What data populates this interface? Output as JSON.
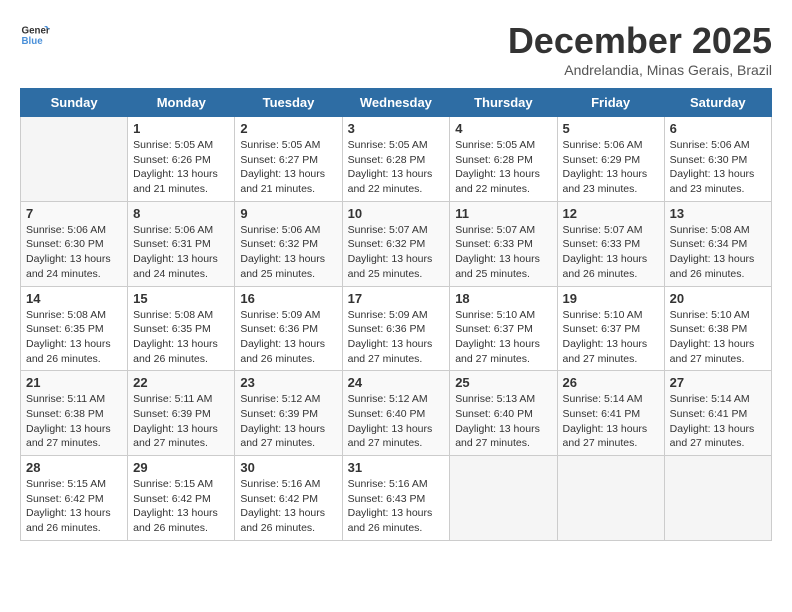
{
  "logo": {
    "general": "General",
    "blue": "Blue"
  },
  "header": {
    "month": "December 2025",
    "location": "Andrelandia, Minas Gerais, Brazil"
  },
  "days_of_week": [
    "Sunday",
    "Monday",
    "Tuesday",
    "Wednesday",
    "Thursday",
    "Friday",
    "Saturday"
  ],
  "weeks": [
    [
      {
        "day": "",
        "info": ""
      },
      {
        "day": "1",
        "info": "Sunrise: 5:05 AM\nSunset: 6:26 PM\nDaylight: 13 hours and 21 minutes."
      },
      {
        "day": "2",
        "info": "Sunrise: 5:05 AM\nSunset: 6:27 PM\nDaylight: 13 hours and 21 minutes."
      },
      {
        "day": "3",
        "info": "Sunrise: 5:05 AM\nSunset: 6:28 PM\nDaylight: 13 hours and 22 minutes."
      },
      {
        "day": "4",
        "info": "Sunrise: 5:05 AM\nSunset: 6:28 PM\nDaylight: 13 hours and 22 minutes."
      },
      {
        "day": "5",
        "info": "Sunrise: 5:06 AM\nSunset: 6:29 PM\nDaylight: 13 hours and 23 minutes."
      },
      {
        "day": "6",
        "info": "Sunrise: 5:06 AM\nSunset: 6:30 PM\nDaylight: 13 hours and 23 minutes."
      }
    ],
    [
      {
        "day": "7",
        "info": "Sunrise: 5:06 AM\nSunset: 6:30 PM\nDaylight: 13 hours and 24 minutes."
      },
      {
        "day": "8",
        "info": "Sunrise: 5:06 AM\nSunset: 6:31 PM\nDaylight: 13 hours and 24 minutes."
      },
      {
        "day": "9",
        "info": "Sunrise: 5:06 AM\nSunset: 6:32 PM\nDaylight: 13 hours and 25 minutes."
      },
      {
        "day": "10",
        "info": "Sunrise: 5:07 AM\nSunset: 6:32 PM\nDaylight: 13 hours and 25 minutes."
      },
      {
        "day": "11",
        "info": "Sunrise: 5:07 AM\nSunset: 6:33 PM\nDaylight: 13 hours and 25 minutes."
      },
      {
        "day": "12",
        "info": "Sunrise: 5:07 AM\nSunset: 6:33 PM\nDaylight: 13 hours and 26 minutes."
      },
      {
        "day": "13",
        "info": "Sunrise: 5:08 AM\nSunset: 6:34 PM\nDaylight: 13 hours and 26 minutes."
      }
    ],
    [
      {
        "day": "14",
        "info": "Sunrise: 5:08 AM\nSunset: 6:35 PM\nDaylight: 13 hours and 26 minutes."
      },
      {
        "day": "15",
        "info": "Sunrise: 5:08 AM\nSunset: 6:35 PM\nDaylight: 13 hours and 26 minutes."
      },
      {
        "day": "16",
        "info": "Sunrise: 5:09 AM\nSunset: 6:36 PM\nDaylight: 13 hours and 26 minutes."
      },
      {
        "day": "17",
        "info": "Sunrise: 5:09 AM\nSunset: 6:36 PM\nDaylight: 13 hours and 27 minutes."
      },
      {
        "day": "18",
        "info": "Sunrise: 5:10 AM\nSunset: 6:37 PM\nDaylight: 13 hours and 27 minutes."
      },
      {
        "day": "19",
        "info": "Sunrise: 5:10 AM\nSunset: 6:37 PM\nDaylight: 13 hours and 27 minutes."
      },
      {
        "day": "20",
        "info": "Sunrise: 5:10 AM\nSunset: 6:38 PM\nDaylight: 13 hours and 27 minutes."
      }
    ],
    [
      {
        "day": "21",
        "info": "Sunrise: 5:11 AM\nSunset: 6:38 PM\nDaylight: 13 hours and 27 minutes."
      },
      {
        "day": "22",
        "info": "Sunrise: 5:11 AM\nSunset: 6:39 PM\nDaylight: 13 hours and 27 minutes."
      },
      {
        "day": "23",
        "info": "Sunrise: 5:12 AM\nSunset: 6:39 PM\nDaylight: 13 hours and 27 minutes."
      },
      {
        "day": "24",
        "info": "Sunrise: 5:12 AM\nSunset: 6:40 PM\nDaylight: 13 hours and 27 minutes."
      },
      {
        "day": "25",
        "info": "Sunrise: 5:13 AM\nSunset: 6:40 PM\nDaylight: 13 hours and 27 minutes."
      },
      {
        "day": "26",
        "info": "Sunrise: 5:14 AM\nSunset: 6:41 PM\nDaylight: 13 hours and 27 minutes."
      },
      {
        "day": "27",
        "info": "Sunrise: 5:14 AM\nSunset: 6:41 PM\nDaylight: 13 hours and 27 minutes."
      }
    ],
    [
      {
        "day": "28",
        "info": "Sunrise: 5:15 AM\nSunset: 6:42 PM\nDaylight: 13 hours and 26 minutes."
      },
      {
        "day": "29",
        "info": "Sunrise: 5:15 AM\nSunset: 6:42 PM\nDaylight: 13 hours and 26 minutes."
      },
      {
        "day": "30",
        "info": "Sunrise: 5:16 AM\nSunset: 6:42 PM\nDaylight: 13 hours and 26 minutes."
      },
      {
        "day": "31",
        "info": "Sunrise: 5:16 AM\nSunset: 6:43 PM\nDaylight: 13 hours and 26 minutes."
      },
      {
        "day": "",
        "info": ""
      },
      {
        "day": "",
        "info": ""
      },
      {
        "day": "",
        "info": ""
      }
    ]
  ]
}
